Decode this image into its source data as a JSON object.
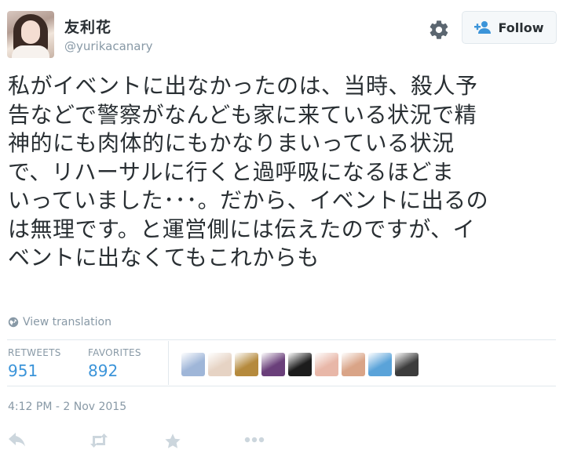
{
  "user": {
    "display_name": "友利花",
    "screen_name": "@yurikacanary"
  },
  "header": {
    "settings_icon": "gear-icon",
    "follow_icon": "follow-person-plus-icon",
    "follow_label": "Follow"
  },
  "tweet": {
    "lines": [
      "私がイベントに出なかったのは、当時、殺人予",
      "告などで警察がなんども家に来ている状況で精",
      "神的にも肉体的にもかなりまいっている状況",
      "で、リハーサルに行くと過呼吸になるほどま",
      "いっていました･･･。だから、イベントに出るの",
      "は無理です。と運営側には伝えたのですが、イ",
      "ベントに出なくてもこれからも"
    ],
    "translate_label": "View translation",
    "translate_icon": "globe-icon"
  },
  "stats": {
    "retweets_label": "RETWEETS",
    "retweets_value": "951",
    "favorites_label": "FAVORITES",
    "favorites_value": "892",
    "favoriter_avatars": [
      {
        "name": "favoriter-avatar-1",
        "color": "#9fb6d8"
      },
      {
        "name": "favoriter-avatar-2",
        "color": "#e6d3c4"
      },
      {
        "name": "favoriter-avatar-3",
        "color": "#b58a3d"
      },
      {
        "name": "favoriter-avatar-4",
        "color": "#6a3f7a"
      },
      {
        "name": "favoriter-avatar-5",
        "color": "#1c1c1c"
      },
      {
        "name": "favoriter-avatar-6",
        "color": "#e8b7a8"
      },
      {
        "name": "favoriter-avatar-7",
        "color": "#d9a487"
      },
      {
        "name": "favoriter-avatar-8",
        "color": "#5aa3d9"
      },
      {
        "name": "favoriter-avatar-9",
        "color": "#3c3c3c"
      }
    ]
  },
  "timestamp": "4:12 PM - 2 Nov 2015",
  "actions": {
    "reply_icon": "reply-icon",
    "retweet_icon": "retweet-icon",
    "favorite_icon": "star-icon",
    "more_icon": "more-dots-icon"
  },
  "colors": {
    "link_blue": "#3b94d9",
    "muted_gray": "#8899a6",
    "text": "#292f33",
    "follow_icon_blue": "#3b94d9"
  }
}
